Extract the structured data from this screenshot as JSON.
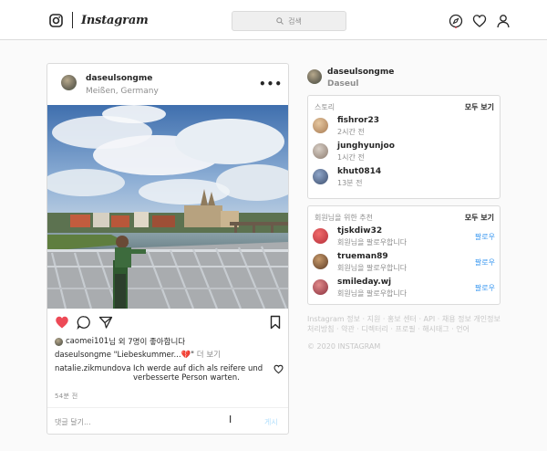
{
  "header": {
    "logo_text": "Instagram",
    "search_placeholder": "검색",
    "icons": [
      "camera-icon",
      "compass-icon",
      "heart-icon",
      "profile-icon"
    ]
  },
  "post": {
    "username": "daseulsongme",
    "location": "Meißen, Germany",
    "menu": "•••",
    "likes_user": "caomei101",
    "likes_text": "님 외 7명이 좋아합니다",
    "caption_user": "daseulsongme",
    "caption_text": "\"Liebeskummer...💔\"",
    "caption_more": "더 보기",
    "comment_user": "natalie.zikmundova",
    "comment_text": "Ich werde auf dich als reifere und verbesserte Person warten.",
    "time": "54분 전",
    "comment_placeholder": "댓글 달기...",
    "post_button": "게시"
  },
  "profile": {
    "username": "daseulsongme",
    "name": "Daseul"
  },
  "stories": {
    "title": "스토리",
    "see_all": "모두 보기",
    "items": [
      {
        "user": "fishror23",
        "time": "2시간 전"
      },
      {
        "user": "junghyunjoo",
        "time": "1시간 전"
      },
      {
        "user": "khut0814",
        "time": "13분 전"
      }
    ]
  },
  "suggestions": {
    "title": "회원님을 위한 추천",
    "see_all": "모두 보기",
    "items": [
      {
        "user": "tjskdiw32",
        "sub": "회원님을 팔로우합니다",
        "action": "팔로우"
      },
      {
        "user": "trueman89",
        "sub": "회원님을 팔로우합니다",
        "action": "팔로우"
      },
      {
        "user": "smileday.wj",
        "sub": "회원님을 팔로우합니다",
        "action": "팔로우"
      }
    ]
  },
  "footer": {
    "links": "Instagram 정보 · 지원 · 홍보 센터 · API · 채용 정보 개인정보처리방침 · 약관 · 디렉터리 · 프로필 · 해시태그 · 언어",
    "copyright": "© 2020 INSTAGRAM"
  },
  "colors": {
    "like_red": "#ed4956",
    "link_blue": "#3897f0",
    "border": "#dbdbdb"
  }
}
